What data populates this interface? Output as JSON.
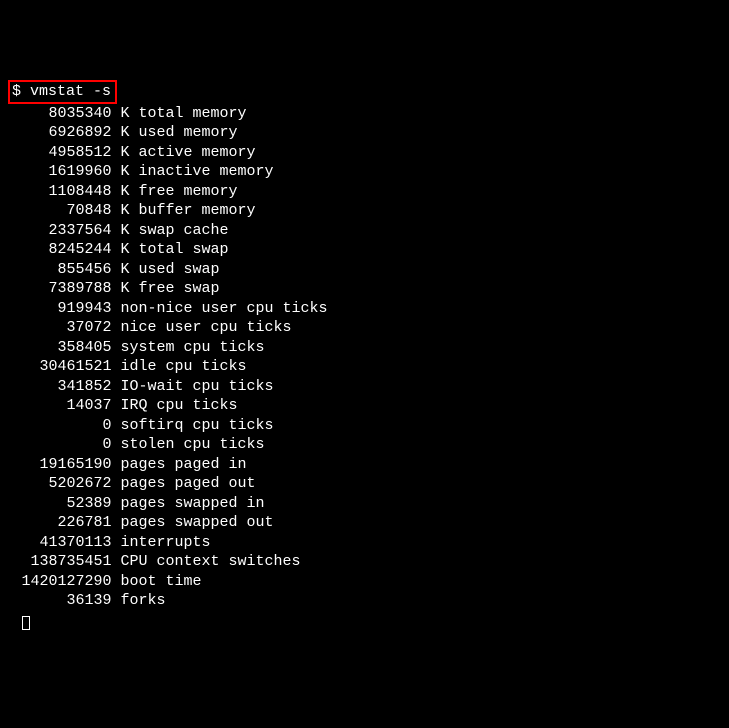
{
  "prompt": "$",
  "command": "vmstat -s",
  "rows": [
    {
      "value": "8035340",
      "label": "K total memory"
    },
    {
      "value": "6926892",
      "label": "K used memory"
    },
    {
      "value": "4958512",
      "label": "K active memory"
    },
    {
      "value": "1619960",
      "label": "K inactive memory"
    },
    {
      "value": "1108448",
      "label": "K free memory"
    },
    {
      "value": "70848",
      "label": "K buffer memory"
    },
    {
      "value": "2337564",
      "label": "K swap cache"
    },
    {
      "value": "8245244",
      "label": "K total swap"
    },
    {
      "value": "855456",
      "label": "K used swap"
    },
    {
      "value": "7389788",
      "label": "K free swap"
    },
    {
      "value": "919943",
      "label": "non-nice user cpu ticks"
    },
    {
      "value": "37072",
      "label": "nice user cpu ticks"
    },
    {
      "value": "358405",
      "label": "system cpu ticks"
    },
    {
      "value": "30461521",
      "label": "idle cpu ticks"
    },
    {
      "value": "341852",
      "label": "IO-wait cpu ticks"
    },
    {
      "value": "14037",
      "label": "IRQ cpu ticks"
    },
    {
      "value": "0",
      "label": "softirq cpu ticks"
    },
    {
      "value": "0",
      "label": "stolen cpu ticks"
    },
    {
      "value": "19165190",
      "label": "pages paged in"
    },
    {
      "value": "5202672",
      "label": "pages paged out"
    },
    {
      "value": "52389",
      "label": "pages swapped in"
    },
    {
      "value": "226781",
      "label": "pages swapped out"
    },
    {
      "value": "41370113",
      "label": "interrupts"
    },
    {
      "value": "138735451",
      "label": "CPU context switches"
    },
    {
      "value": "1420127290",
      "label": "boot time"
    },
    {
      "value": "36139",
      "label": "forks"
    }
  ]
}
